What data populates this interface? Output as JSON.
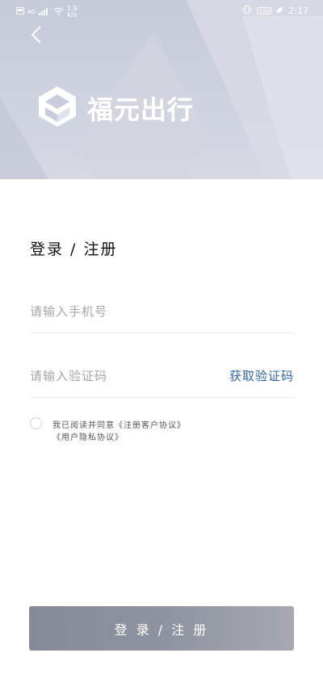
{
  "status_bar": {
    "signal_label": "4G",
    "speed_value": "1.9",
    "speed_unit": "K/s",
    "battery": "100",
    "time": "2:17"
  },
  "header": {
    "brand_name": "福元出行",
    "back_icon": "chevron-left-icon",
    "logo_icon": "fuyuan-logo-icon"
  },
  "form": {
    "title": "登录 / 注册",
    "phone_placeholder": "请输入手机号",
    "code_placeholder": "请输入验证码",
    "get_code_label": "获取验证码",
    "agreement_prefix": "我已阅读并同意",
    "agreement_link1": "《注册客户协议》",
    "agreement_link2": "《用户隐私协议》",
    "submit_label": "登 录 / 注 册"
  },
  "colors": {
    "banner": "#cfd2df",
    "link": "#2f67a8",
    "button": "#8c909c"
  }
}
